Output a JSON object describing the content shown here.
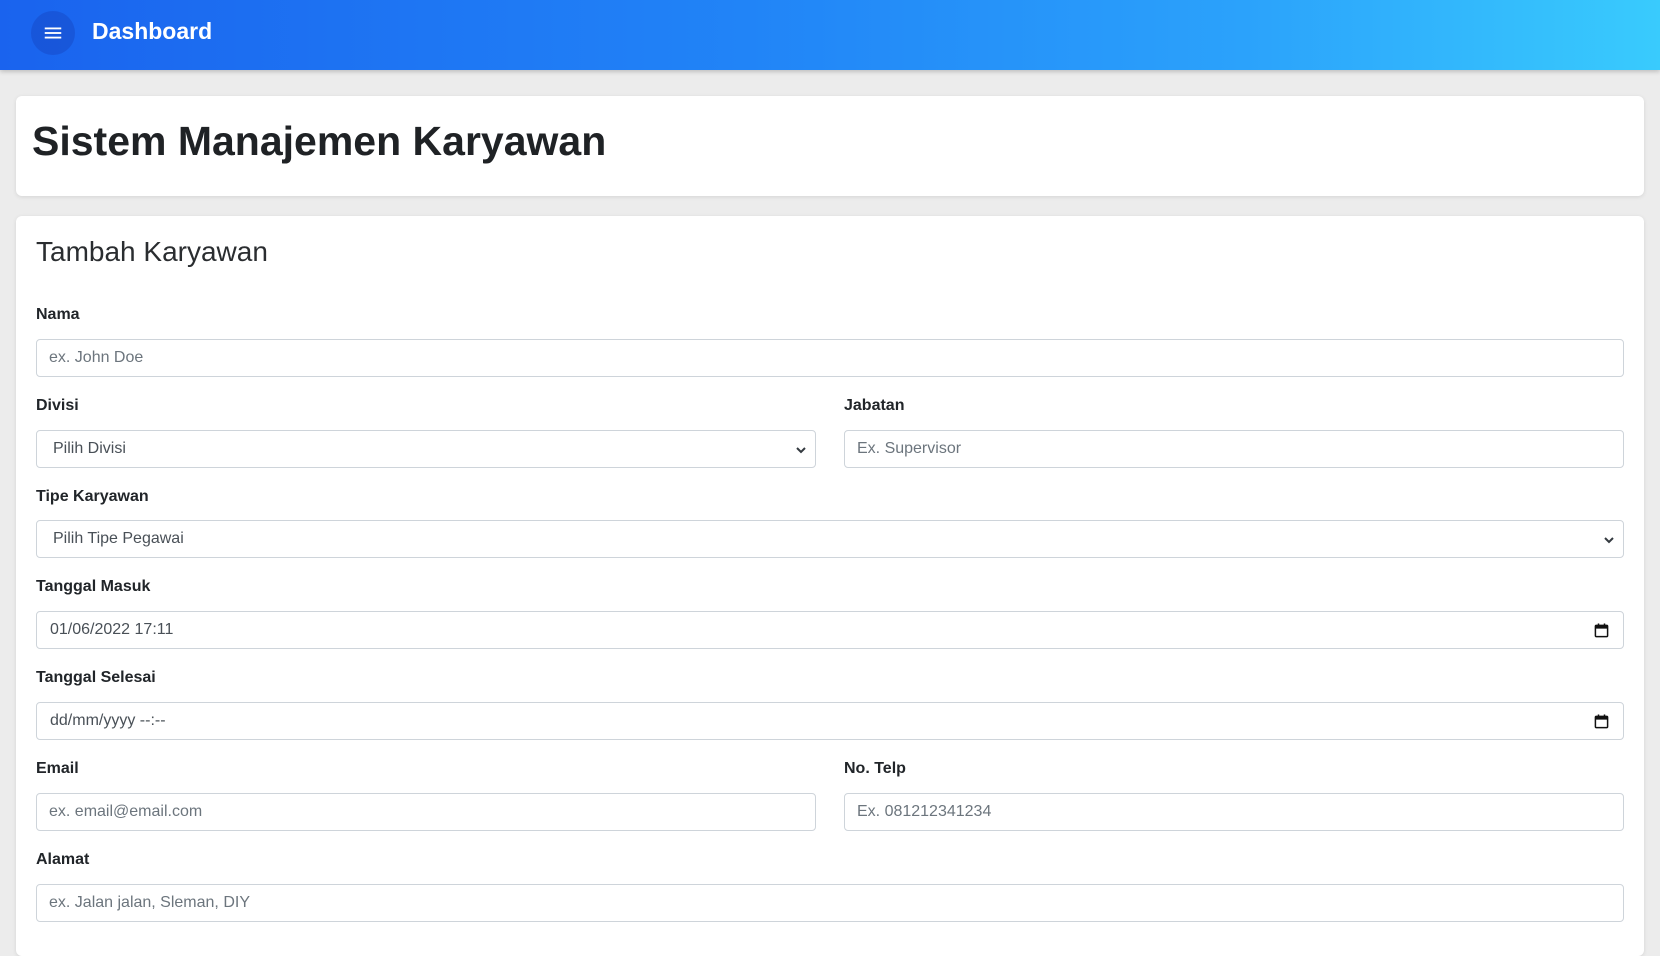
{
  "appbar": {
    "title": "Dashboard",
    "menu_icon": "hamburger-menu-icon",
    "gradient": [
      "#1a63ee",
      "#39cbfd"
    ]
  },
  "header": {
    "title": "Sistem Manajemen Karyawan"
  },
  "form": {
    "title": "Tambah Karyawan",
    "nama": {
      "label": "Nama",
      "placeholder": "ex. John Doe"
    },
    "divisi": {
      "label": "Divisi",
      "selected": "Pilih Divisi"
    },
    "jabatan": {
      "label": "Jabatan",
      "placeholder": "Ex. Supervisor"
    },
    "tipe": {
      "label": "Tipe Karyawan",
      "selected": "Pilih Tipe Pegawai"
    },
    "tanggal_masuk": {
      "label": "Tanggal Masuk",
      "value": "01/06/2022 17:11"
    },
    "tanggal_selesai": {
      "label": "Tanggal Selesai",
      "value": "dd/mm/yyyy --:--"
    },
    "email": {
      "label": "Email",
      "placeholder": "ex. email@email.com"
    },
    "telp": {
      "label": "No. Telp",
      "placeholder": "Ex. 081212341234"
    },
    "alamat": {
      "label": "Alamat",
      "placeholder": "ex. Jalan jalan, Sleman, DIY"
    }
  }
}
